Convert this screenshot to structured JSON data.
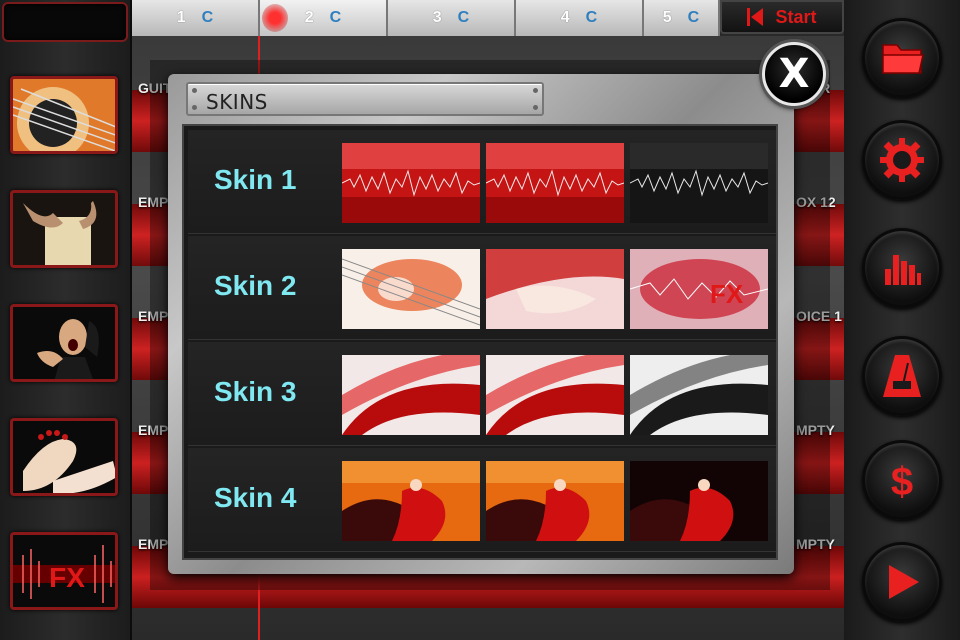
{
  "tabs": [
    {
      "number": "1",
      "key": "C"
    },
    {
      "number": "2",
      "key": "C"
    },
    {
      "number": "3",
      "key": "C"
    },
    {
      "number": "4",
      "key": "C"
    },
    {
      "number": "5",
      "key": "C"
    }
  ],
  "start_button": {
    "label": "Start"
  },
  "tracks": [
    {
      "left_label": "GUIT",
      "right_label": "AR"
    },
    {
      "left_label": "EMP",
      "right_label": "OX 12"
    },
    {
      "left_label": "EMP",
      "right_label": "OICE 1"
    },
    {
      "left_label": "EMP",
      "right_label": "MPTY"
    },
    {
      "left_label": "EMP",
      "right_label": "MPTY"
    }
  ],
  "instrument_thumbs": [
    "guitar",
    "cajon",
    "voice",
    "palmas",
    "fx"
  ],
  "right_controls": [
    "folder-icon",
    "gear-icon",
    "mixer-icon",
    "metronome-icon",
    "dollar-icon",
    "play-icon"
  ],
  "skins_dialog": {
    "title": "SKINS",
    "close_label": "X",
    "skins": [
      {
        "name": "Skin 1"
      },
      {
        "name": "Skin 2"
      },
      {
        "name": "Skin 3"
      },
      {
        "name": "Skin 4"
      }
    ]
  },
  "colors": {
    "accent_red": "#d81818",
    "skin_label": "#7fe8f0",
    "key_blue": "#2f7fbf"
  }
}
